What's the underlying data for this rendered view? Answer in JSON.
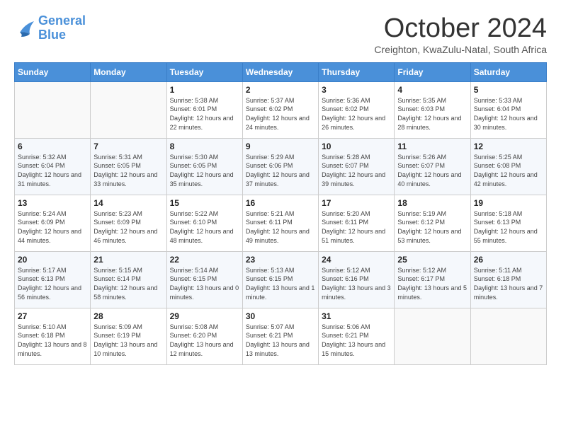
{
  "logo": {
    "line1": "General",
    "line2": "Blue"
  },
  "title": "October 2024",
  "subtitle": "Creighton, KwaZulu-Natal, South Africa",
  "days_header": [
    "Sunday",
    "Monday",
    "Tuesday",
    "Wednesday",
    "Thursday",
    "Friday",
    "Saturday"
  ],
  "weeks": [
    [
      {
        "num": "",
        "sunrise": "",
        "sunset": "",
        "daylight": ""
      },
      {
        "num": "",
        "sunrise": "",
        "sunset": "",
        "daylight": ""
      },
      {
        "num": "1",
        "sunrise": "Sunrise: 5:38 AM",
        "sunset": "Sunset: 6:01 PM",
        "daylight": "Daylight: 12 hours and 22 minutes."
      },
      {
        "num": "2",
        "sunrise": "Sunrise: 5:37 AM",
        "sunset": "Sunset: 6:02 PM",
        "daylight": "Daylight: 12 hours and 24 minutes."
      },
      {
        "num": "3",
        "sunrise": "Sunrise: 5:36 AM",
        "sunset": "Sunset: 6:02 PM",
        "daylight": "Daylight: 12 hours and 26 minutes."
      },
      {
        "num": "4",
        "sunrise": "Sunrise: 5:35 AM",
        "sunset": "Sunset: 6:03 PM",
        "daylight": "Daylight: 12 hours and 28 minutes."
      },
      {
        "num": "5",
        "sunrise": "Sunrise: 5:33 AM",
        "sunset": "Sunset: 6:04 PM",
        "daylight": "Daylight: 12 hours and 30 minutes."
      }
    ],
    [
      {
        "num": "6",
        "sunrise": "Sunrise: 5:32 AM",
        "sunset": "Sunset: 6:04 PM",
        "daylight": "Daylight: 12 hours and 31 minutes."
      },
      {
        "num": "7",
        "sunrise": "Sunrise: 5:31 AM",
        "sunset": "Sunset: 6:05 PM",
        "daylight": "Daylight: 12 hours and 33 minutes."
      },
      {
        "num": "8",
        "sunrise": "Sunrise: 5:30 AM",
        "sunset": "Sunset: 6:05 PM",
        "daylight": "Daylight: 12 hours and 35 minutes."
      },
      {
        "num": "9",
        "sunrise": "Sunrise: 5:29 AM",
        "sunset": "Sunset: 6:06 PM",
        "daylight": "Daylight: 12 hours and 37 minutes."
      },
      {
        "num": "10",
        "sunrise": "Sunrise: 5:28 AM",
        "sunset": "Sunset: 6:07 PM",
        "daylight": "Daylight: 12 hours and 39 minutes."
      },
      {
        "num": "11",
        "sunrise": "Sunrise: 5:26 AM",
        "sunset": "Sunset: 6:07 PM",
        "daylight": "Daylight: 12 hours and 40 minutes."
      },
      {
        "num": "12",
        "sunrise": "Sunrise: 5:25 AM",
        "sunset": "Sunset: 6:08 PM",
        "daylight": "Daylight: 12 hours and 42 minutes."
      }
    ],
    [
      {
        "num": "13",
        "sunrise": "Sunrise: 5:24 AM",
        "sunset": "Sunset: 6:09 PM",
        "daylight": "Daylight: 12 hours and 44 minutes."
      },
      {
        "num": "14",
        "sunrise": "Sunrise: 5:23 AM",
        "sunset": "Sunset: 6:09 PM",
        "daylight": "Daylight: 12 hours and 46 minutes."
      },
      {
        "num": "15",
        "sunrise": "Sunrise: 5:22 AM",
        "sunset": "Sunset: 6:10 PM",
        "daylight": "Daylight: 12 hours and 48 minutes."
      },
      {
        "num": "16",
        "sunrise": "Sunrise: 5:21 AM",
        "sunset": "Sunset: 6:11 PM",
        "daylight": "Daylight: 12 hours and 49 minutes."
      },
      {
        "num": "17",
        "sunrise": "Sunrise: 5:20 AM",
        "sunset": "Sunset: 6:11 PM",
        "daylight": "Daylight: 12 hours and 51 minutes."
      },
      {
        "num": "18",
        "sunrise": "Sunrise: 5:19 AM",
        "sunset": "Sunset: 6:12 PM",
        "daylight": "Daylight: 12 hours and 53 minutes."
      },
      {
        "num": "19",
        "sunrise": "Sunrise: 5:18 AM",
        "sunset": "Sunset: 6:13 PM",
        "daylight": "Daylight: 12 hours and 55 minutes."
      }
    ],
    [
      {
        "num": "20",
        "sunrise": "Sunrise: 5:17 AM",
        "sunset": "Sunset: 6:13 PM",
        "daylight": "Daylight: 12 hours and 56 minutes."
      },
      {
        "num": "21",
        "sunrise": "Sunrise: 5:15 AM",
        "sunset": "Sunset: 6:14 PM",
        "daylight": "Daylight: 12 hours and 58 minutes."
      },
      {
        "num": "22",
        "sunrise": "Sunrise: 5:14 AM",
        "sunset": "Sunset: 6:15 PM",
        "daylight": "Daylight: 13 hours and 0 minutes."
      },
      {
        "num": "23",
        "sunrise": "Sunrise: 5:13 AM",
        "sunset": "Sunset: 6:15 PM",
        "daylight": "Daylight: 13 hours and 1 minute."
      },
      {
        "num": "24",
        "sunrise": "Sunrise: 5:12 AM",
        "sunset": "Sunset: 6:16 PM",
        "daylight": "Daylight: 13 hours and 3 minutes."
      },
      {
        "num": "25",
        "sunrise": "Sunrise: 5:12 AM",
        "sunset": "Sunset: 6:17 PM",
        "daylight": "Daylight: 13 hours and 5 minutes."
      },
      {
        "num": "26",
        "sunrise": "Sunrise: 5:11 AM",
        "sunset": "Sunset: 6:18 PM",
        "daylight": "Daylight: 13 hours and 7 minutes."
      }
    ],
    [
      {
        "num": "27",
        "sunrise": "Sunrise: 5:10 AM",
        "sunset": "Sunset: 6:18 PM",
        "daylight": "Daylight: 13 hours and 8 minutes."
      },
      {
        "num": "28",
        "sunrise": "Sunrise: 5:09 AM",
        "sunset": "Sunset: 6:19 PM",
        "daylight": "Daylight: 13 hours and 10 minutes."
      },
      {
        "num": "29",
        "sunrise": "Sunrise: 5:08 AM",
        "sunset": "Sunset: 6:20 PM",
        "daylight": "Daylight: 13 hours and 12 minutes."
      },
      {
        "num": "30",
        "sunrise": "Sunrise: 5:07 AM",
        "sunset": "Sunset: 6:21 PM",
        "daylight": "Daylight: 13 hours and 13 minutes."
      },
      {
        "num": "31",
        "sunrise": "Sunrise: 5:06 AM",
        "sunset": "Sunset: 6:21 PM",
        "daylight": "Daylight: 13 hours and 15 minutes."
      },
      {
        "num": "",
        "sunrise": "",
        "sunset": "",
        "daylight": ""
      },
      {
        "num": "",
        "sunrise": "",
        "sunset": "",
        "daylight": ""
      }
    ]
  ]
}
